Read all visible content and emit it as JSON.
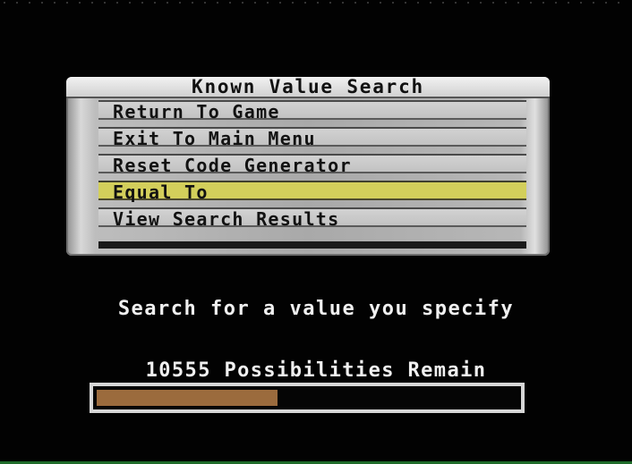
{
  "menu": {
    "title": "Known Value Search",
    "items": [
      {
        "label": "Return To Game",
        "selected": false
      },
      {
        "label": "Exit To Main Menu",
        "selected": false
      },
      {
        "label": "Reset Code Generator",
        "selected": false
      },
      {
        "label": "Equal To",
        "selected": true
      },
      {
        "label": "View Search Results",
        "selected": false
      }
    ]
  },
  "description": "Search for a value you specify",
  "status": {
    "remaining_text": "10555 Possibilities Remain",
    "progress_fraction": 0.43
  },
  "colors": {
    "background": "#000000",
    "menu_item": "#c7c7c7",
    "selected_item": "#d3cf5b",
    "progress_fill": "#9b6b3d",
    "text": "#f0f0f0"
  }
}
